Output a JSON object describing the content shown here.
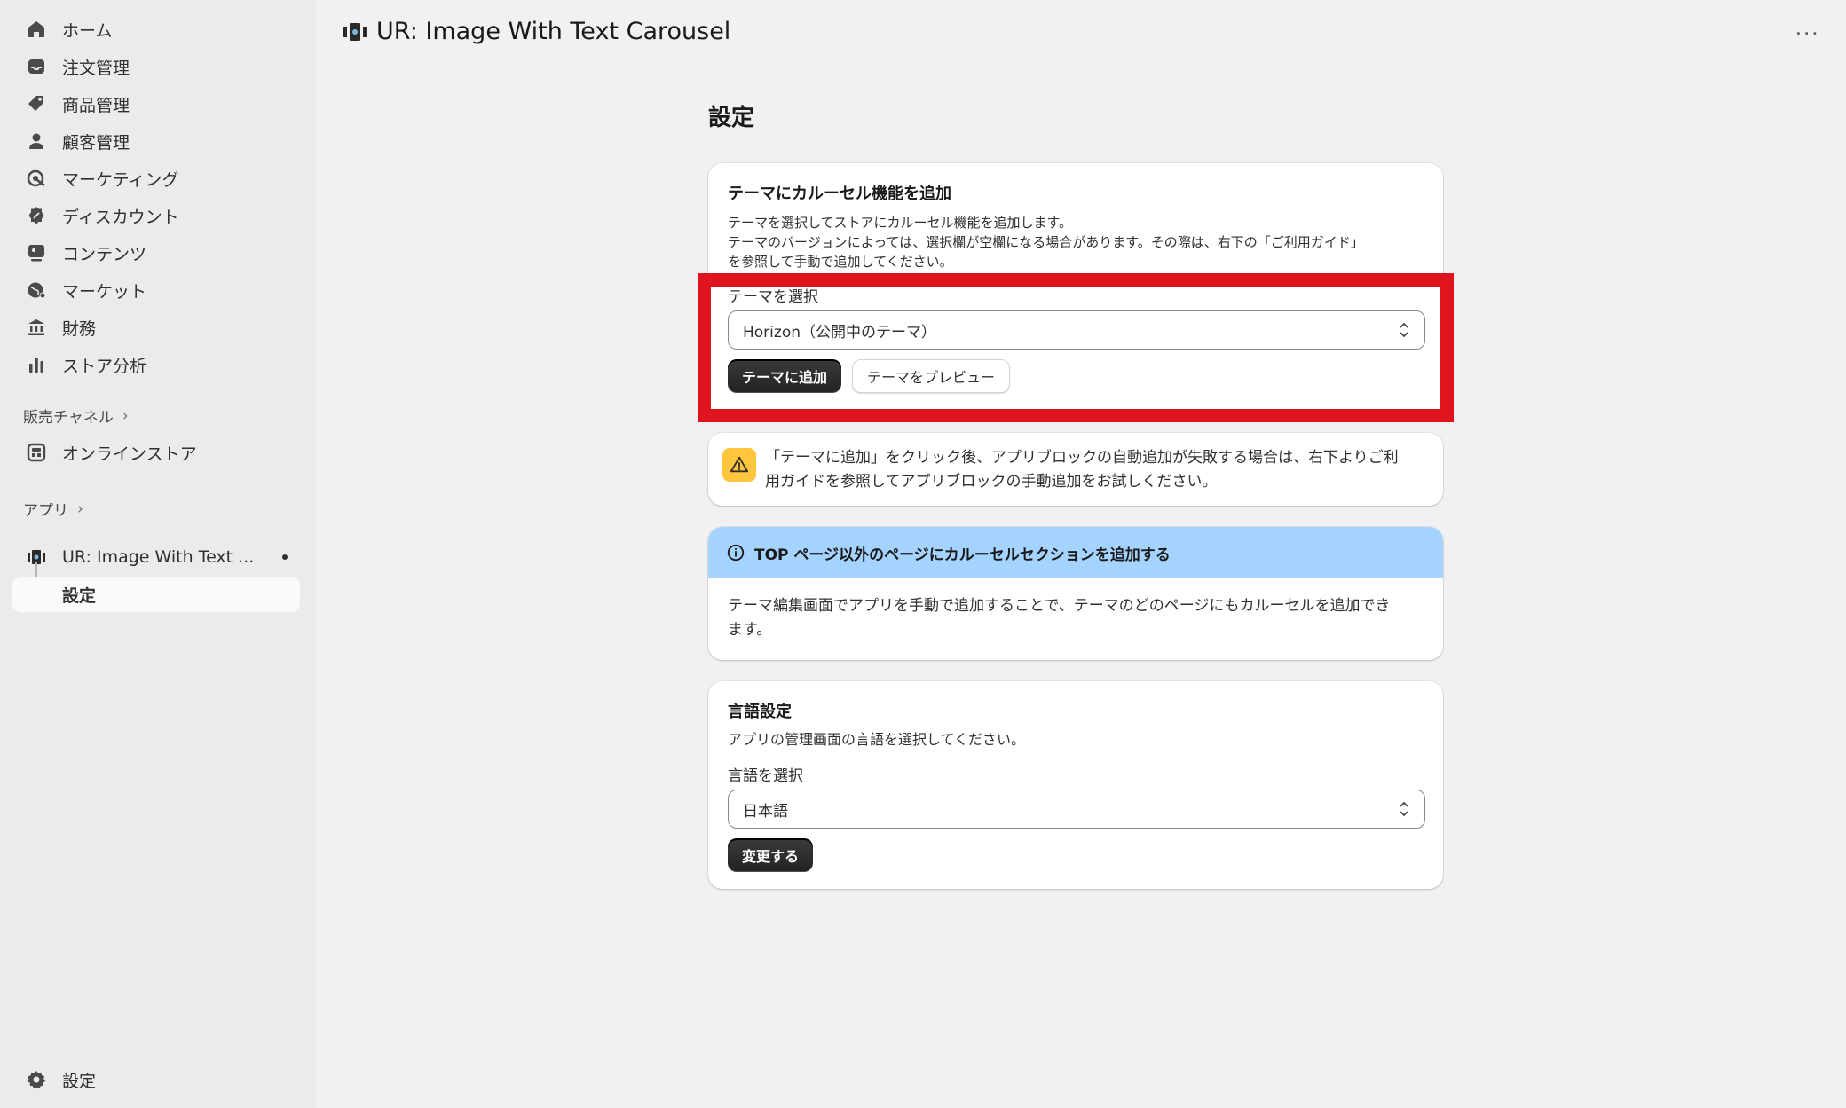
{
  "sidebar": {
    "items": [
      {
        "label": "ホーム",
        "icon": "home-icon"
      },
      {
        "label": "注文管理",
        "icon": "inbox-icon"
      },
      {
        "label": "商品管理",
        "icon": "tag-icon"
      },
      {
        "label": "顧客管理",
        "icon": "person-icon"
      },
      {
        "label": "マーケティング",
        "icon": "target-icon"
      },
      {
        "label": "ディスカウント",
        "icon": "discount-icon"
      },
      {
        "label": "コンテンツ",
        "icon": "content-icon"
      },
      {
        "label": "マーケット",
        "icon": "globe-icon"
      },
      {
        "label": "財務",
        "icon": "bank-icon"
      },
      {
        "label": "ストア分析",
        "icon": "chart-icon"
      }
    ],
    "sales_channels_label": "販売チャネル",
    "online_store_label": "オンラインストア",
    "apps_label": "アプリ",
    "app_item_label": "UR: Image With Text ...",
    "app_sub_label": "設定",
    "settings_label": "設定"
  },
  "header": {
    "app_title": "UR: Image With Text Carousel",
    "more": "···"
  },
  "main": {
    "heading": "設定",
    "theme_card": {
      "title": "テーマにカルーセル機能を追加",
      "desc_line1": "テーマを選択してストアにカルーセル機能を追加します。",
      "desc_line2": "テーマのバージョンによっては、選択欄が空欄になる場合があります。その際は、右下の「ご利用ガイド」",
      "desc_line3": "を参照して手動で追加してください。",
      "select_label": "テーマを選択",
      "select_value": "Horizon（公開中のテーマ）",
      "add_button": "テーマに追加",
      "preview_button": "テーマをプレビュー"
    },
    "warning": {
      "line1": "「テーマに追加」をクリック後、アプリブロックの自動追加が失敗する場合は、右下よりご利",
      "line2": "用ガイドを参照してアプリブロックの手動追加をお試しください。"
    },
    "info_banner": {
      "title": "TOP ページ以外のページにカルーセルセクションを追加する",
      "line1": "テーマ編集画面でアプリを手動で追加することで、テーマのどのページにもカルーセルを追加でき",
      "line2": "ます。"
    },
    "language_card": {
      "title": "言語設定",
      "desc": "アプリの管理画面の言語を選択してください。",
      "select_label": "言語を選択",
      "select_value": "日本語",
      "change_button": "変更する"
    }
  },
  "colors": {
    "highlight": "#e0141c",
    "info_banner": "#a4d3ff",
    "warning_icon": "#ffc53d",
    "primary_button": "#2b2b2b"
  }
}
